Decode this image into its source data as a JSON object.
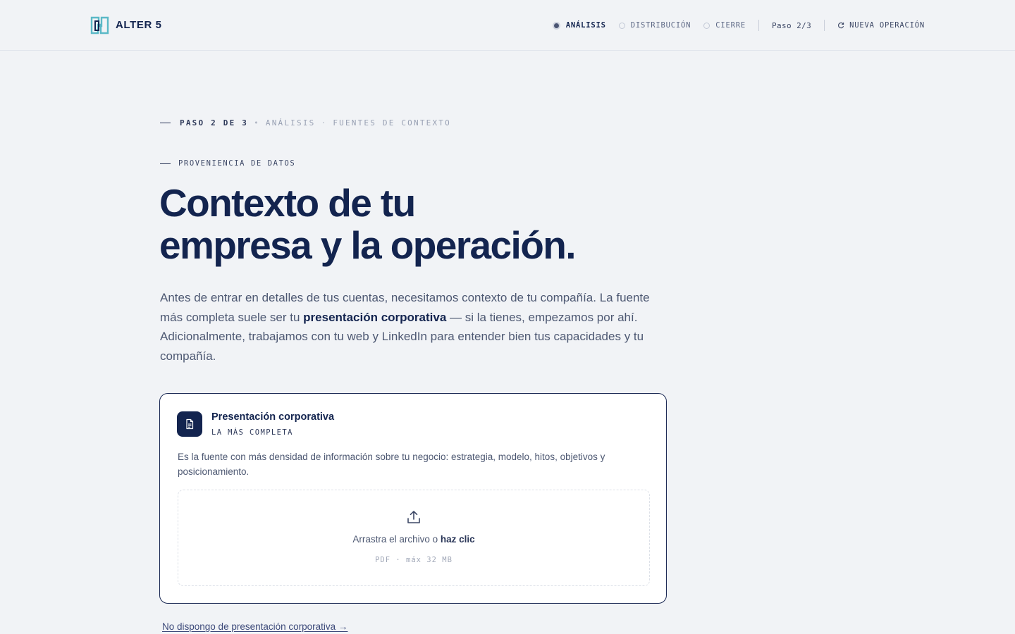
{
  "brand": {
    "name": "ALTER 5",
    "accent": "#5bb9c7",
    "navy": "#13244f"
  },
  "nav": {
    "steps": [
      {
        "label": "ANÁLISIS",
        "state": "active"
      },
      {
        "label": "DISTRIBUCIÓN",
        "state": "pending"
      },
      {
        "label": "CIERRE",
        "state": "pending"
      }
    ],
    "progress": "Paso 2/3",
    "new_operation": "NUEVA OPERACIÓN",
    "new_operation_icon": "refresh-icon"
  },
  "breadcrumb": {
    "step": "PASO 2 DE 3",
    "section": "ANÁLISIS",
    "subsection": "FUENTES DE CONTEXTO",
    "separator": "•"
  },
  "eyebrow": "PROVENIENCIA DE DATOS",
  "title": {
    "line1": "Contexto de tu",
    "line2": "empresa y la operación."
  },
  "lede": {
    "part1": "Antes de entrar en detalles de tus cuentas, necesitamos contexto de tu compañía. La fuente más completa suele ser tu ",
    "bold": "presentación corporativa",
    "part2": " — si la tienes, empezamos por ahí. Adicionalmente, trabajamos con tu web y LinkedIn para entender bien tus capacidades y tu compañía."
  },
  "card": {
    "icon": "document-icon",
    "title": "Presentación corporativa",
    "subtitle": "LA MÁS COMPLETA",
    "description": "Es la fuente con más densidad de información sobre tu negocio: estrategia, modelo, hitos, objetivos y posicionamiento.",
    "dropzone": {
      "icon": "upload-icon",
      "text": "Arrastra el archivo o ",
      "action": "haz clic",
      "note": "PDF · máx 32 MB"
    }
  },
  "no_presentation_link": "No dispongo de presentación corporativa →"
}
